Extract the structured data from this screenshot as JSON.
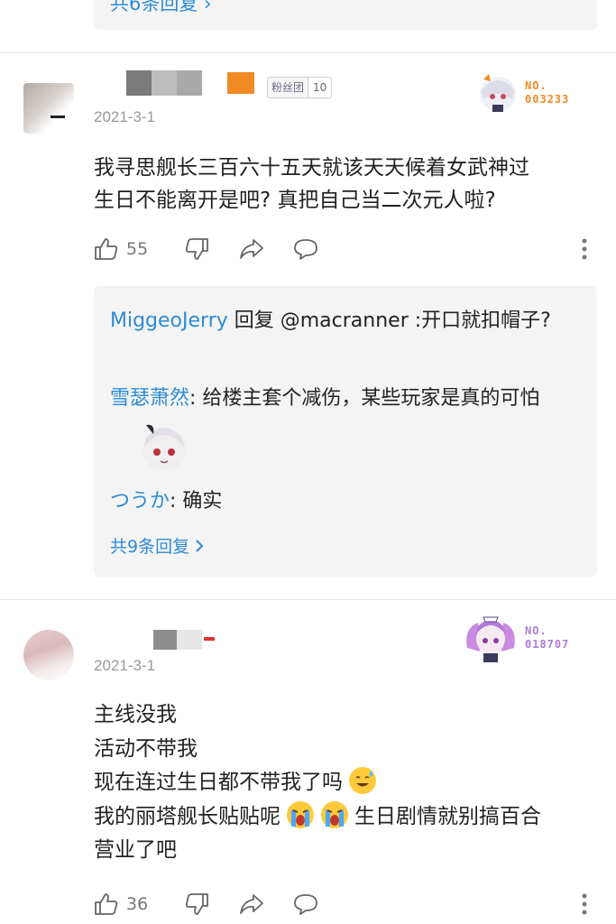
{
  "prev_reply": {
    "more_label": "共6条回复"
  },
  "comments": [
    {
      "date": "2021-3-1",
      "fan_badge": {
        "label": "粉丝团",
        "level": "10"
      },
      "deco_badge": {
        "number_label": "NO.",
        "number": "003233",
        "color": "#f08a24"
      },
      "content_lines": [
        "我寻思舰长三百六十五天就该天天候着女武神过",
        "生日不能离开是吧? 真把自己当二次元人啦?"
      ],
      "likes": "55",
      "replies": [
        {
          "user": "MiggeoJerry",
          "text": " 回复 @macranner :开口就扣帽子?"
        },
        {
          "user": "雪瑟萧然",
          "text": ": 给楼主套个减伤，某些玩家是真的可怕"
        },
        {
          "user": "つうか",
          "text": ": 确实"
        }
      ],
      "more_label": "共9条回复"
    },
    {
      "date": "2021-3-1",
      "deco_badge": {
        "number_label": "NO.",
        "number": "018707",
        "color": "#b07ad8"
      },
      "content_lines": [
        "主线没我",
        "活动不带我",
        "现在连过生日都不带我了吗",
        "我的丽塔舰长贴贴呢",
        "生日剧情就别搞百合",
        "营业了吧"
      ],
      "likes": "36"
    }
  ]
}
